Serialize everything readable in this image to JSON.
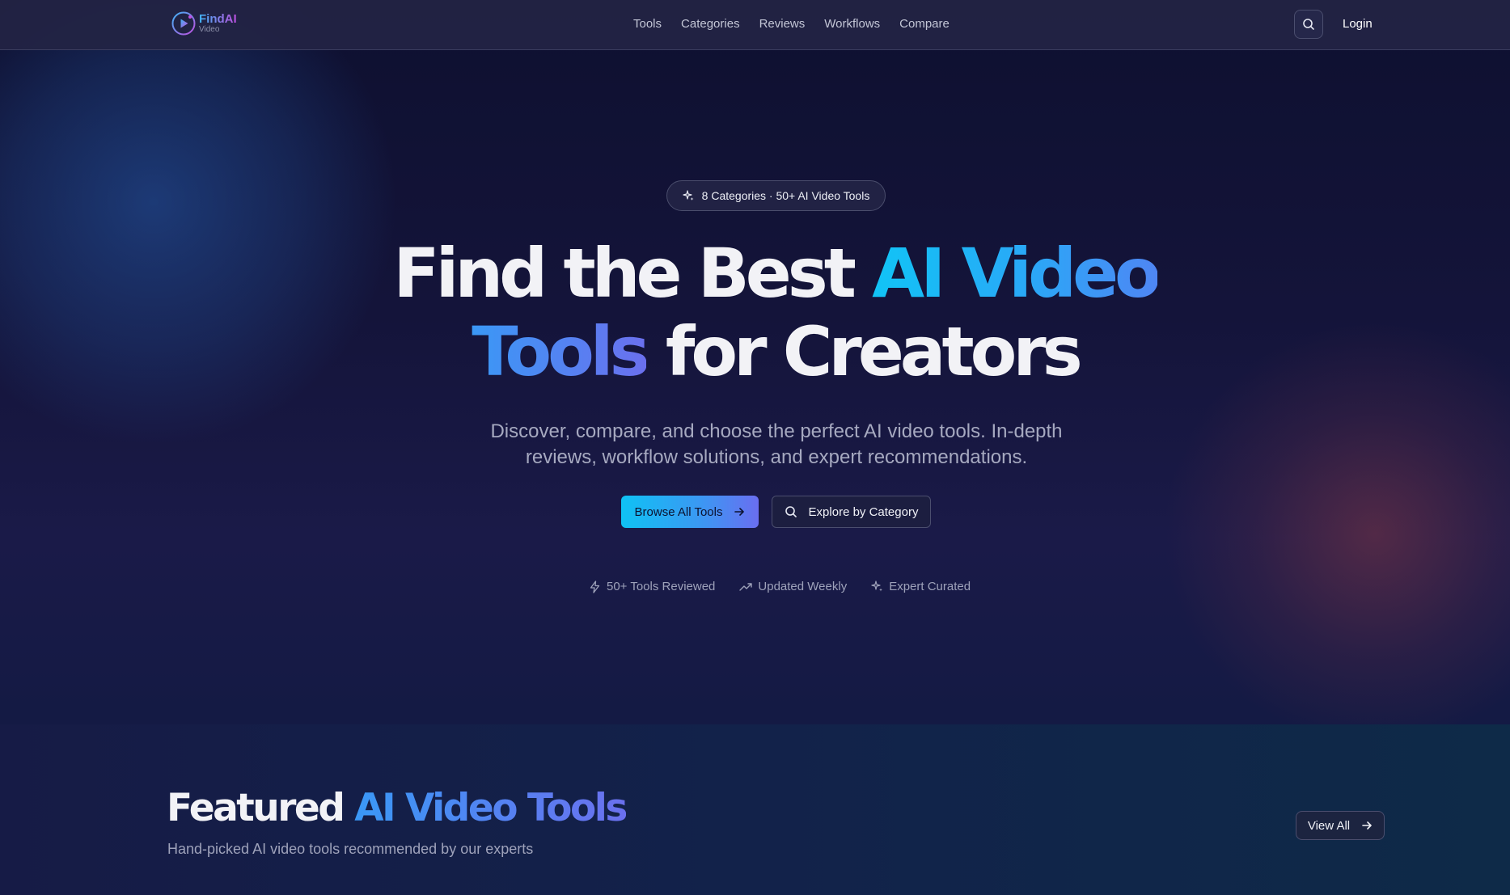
{
  "brand": {
    "name": "FindAI",
    "sub": "Video",
    "logo_icon": "play-circle-icon"
  },
  "nav": {
    "items": [
      "Tools",
      "Categories",
      "Reviews",
      "Workflows",
      "Compare"
    ],
    "search_icon": "search-icon",
    "login_label": "Login"
  },
  "hero": {
    "badge_icon": "sparkles-icon",
    "badge_text": "8 Categories · 50+ AI Video Tools",
    "headline": {
      "part1": "Find the Best ",
      "highlight1": "AI Video",
      "highlight2": "Tools",
      "part2": " for Creators"
    },
    "subtitle": "Discover, compare, and choose the perfect AI video tools. In-depth reviews, workflow solutions, and expert recommendations.",
    "primary_button": {
      "label": "Browse All Tools",
      "icon": "arrow-right-icon"
    },
    "secondary_button": {
      "label": "Explore by Category",
      "icon": "search-icon"
    },
    "stats": [
      {
        "icon": "lightning-icon",
        "label": "50+ Tools Reviewed"
      },
      {
        "icon": "trending-up-icon",
        "label": "Updated Weekly"
      },
      {
        "icon": "sparkles-icon",
        "label": "Expert Curated"
      }
    ]
  },
  "featured": {
    "title_plain": "Featured ",
    "title_highlight": "AI Video Tools",
    "subtitle": "Hand-picked AI video tools recommended by our experts",
    "view_all_label": "View All",
    "view_all_icon": "arrow-right-icon"
  },
  "colors": {
    "accent_cyan": "#11c4f6",
    "accent_indigo": "#6b70ee",
    "background": "#0f1130"
  }
}
